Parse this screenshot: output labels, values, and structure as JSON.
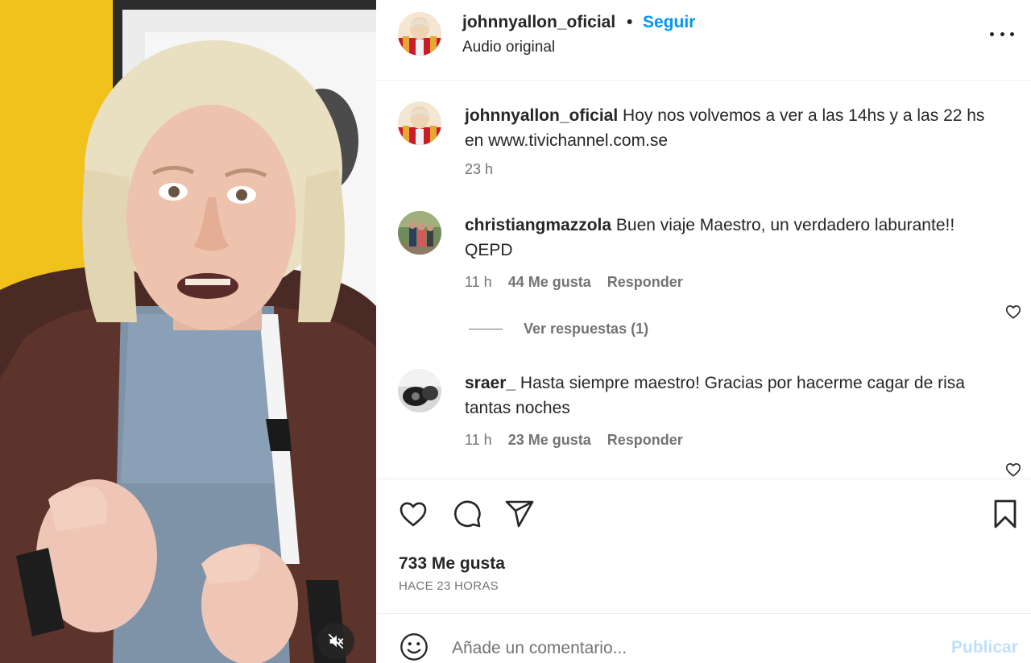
{
  "media": {
    "type": "video",
    "icons": {
      "mute": "speaker-muted-icon"
    }
  },
  "header": {
    "username": "johnnyallon_oficial",
    "separator": "•",
    "follow_label": "Seguir",
    "audio_label": "Audio original",
    "icons": {
      "more": "more-options-icon"
    }
  },
  "caption": {
    "username": "johnnyallon_oficial",
    "text": "Hoy nos volvemos a ver a las 14hs y a las 22 hs en www.tivichannel.com.se",
    "time": "23 h"
  },
  "comments": [
    {
      "username": "christiangmazzola",
      "text": "Buen viaje Maestro, un verdadero laburante!! QEPD",
      "time": "11 h",
      "likes": "44 Me gusta",
      "reply_label": "Responder",
      "view_replies": "Ver respuestas (1)"
    },
    {
      "username": "sraer_",
      "text": "Hasta siempre maestro! Gracias por hacerme cagar de risa tantas noches",
      "time": "11 h",
      "likes": "23 Me gusta",
      "reply_label": "Responder"
    }
  ],
  "actions": {
    "icons": [
      "heart-icon",
      "comment-icon",
      "share-icon",
      "bookmark-icon"
    ]
  },
  "stats": {
    "likes": "733 Me gusta",
    "date": "HACE 23 HORAS"
  },
  "composer": {
    "placeholder": "Añade un comentario...",
    "publish_label": "Publicar"
  },
  "colors": {
    "accent": "#0095f6",
    "publish_disabled": "#c0dffd",
    "text_primary": "#262626",
    "text_secondary": "#737373",
    "divider": "#efefef"
  }
}
